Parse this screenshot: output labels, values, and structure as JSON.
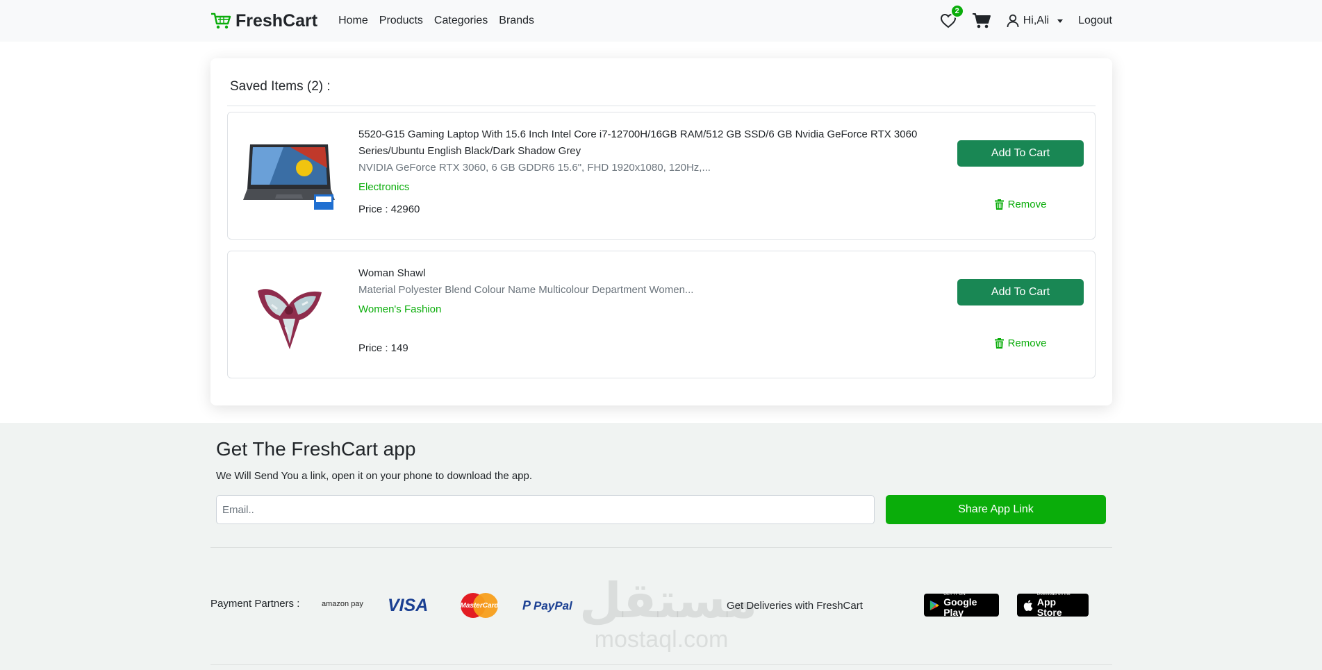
{
  "navbar": {
    "brand": "FreshCart",
    "links": [
      "Home",
      "Products",
      "Categories",
      "Brands"
    ],
    "wishlist_count": "2",
    "greeting": "Hi,Ali",
    "logout": "Logout"
  },
  "saved": {
    "title": "Saved Items (2) :",
    "items": [
      {
        "name": "5520-G15 Gaming Laptop With 15.6 Inch Intel Core i7-12700H/16GB RAM/512 GB SSD/6 GB Nvidia GeForce RTX 3060 Series/Ubuntu English Black/Dark Shadow Grey",
        "description": "NVIDIA GeForce RTX 3060, 6 GB GDDR6 15.6\", FHD 1920x1080, 120Hz,...",
        "category": "Electronics",
        "price": "Price : 42960",
        "add_label": "Add To Cart",
        "remove_label": "Remove",
        "image_icon": "laptop-image"
      },
      {
        "name": "Woman Shawl",
        "description": "Material Polyester Blend Colour Name Multicolour Department Women...",
        "category": "Women's Fashion",
        "price": "Price : 149",
        "add_label": "Add To Cart",
        "remove_label": "Remove",
        "image_icon": "shawl-image"
      }
    ]
  },
  "app": {
    "title": "Get The FreshCart app",
    "subtitle": "We Will Send You a link, open it on your phone to download the app.",
    "email_placeholder": "Email..",
    "share_label": "Share App Link"
  },
  "footer": {
    "payment_label": "Payment Partners :",
    "payment_partners": [
      "amazon pay",
      "VISA",
      "MasterCard",
      "PayPal"
    ],
    "deliveries_label": "Get Deliveries with FreshCart",
    "google_play": {
      "small": "GET IT ON",
      "big": "Google Play"
    },
    "app_store": {
      "small": "Download on the",
      "big": "App Store"
    },
    "watermark_ar": "مستقل",
    "watermark_en": "mostaql.com"
  },
  "colors": {
    "accent": "#0aad0a",
    "add_to_cart": "#198754",
    "navbar_bg": "#f8f9fa",
    "footer_bg": "#f0f3f2"
  }
}
